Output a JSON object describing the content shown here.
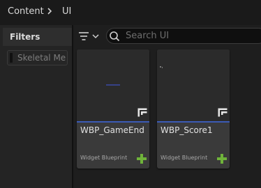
{
  "breadcrumb": {
    "root": "Content",
    "current": "UI"
  },
  "sidebar": {
    "filters_title": "Filters",
    "filter_chip": "Skeletal Me"
  },
  "search": {
    "placeholder": "Search UI"
  },
  "assets": [
    {
      "name": "WBP_GameEnd",
      "type": "Widget Blueprint"
    },
    {
      "name": "WBP_Score1",
      "type": "Widget Blueprint"
    }
  ],
  "colors": {
    "accent": "#3b5bb5",
    "add": "#6fb33a"
  }
}
